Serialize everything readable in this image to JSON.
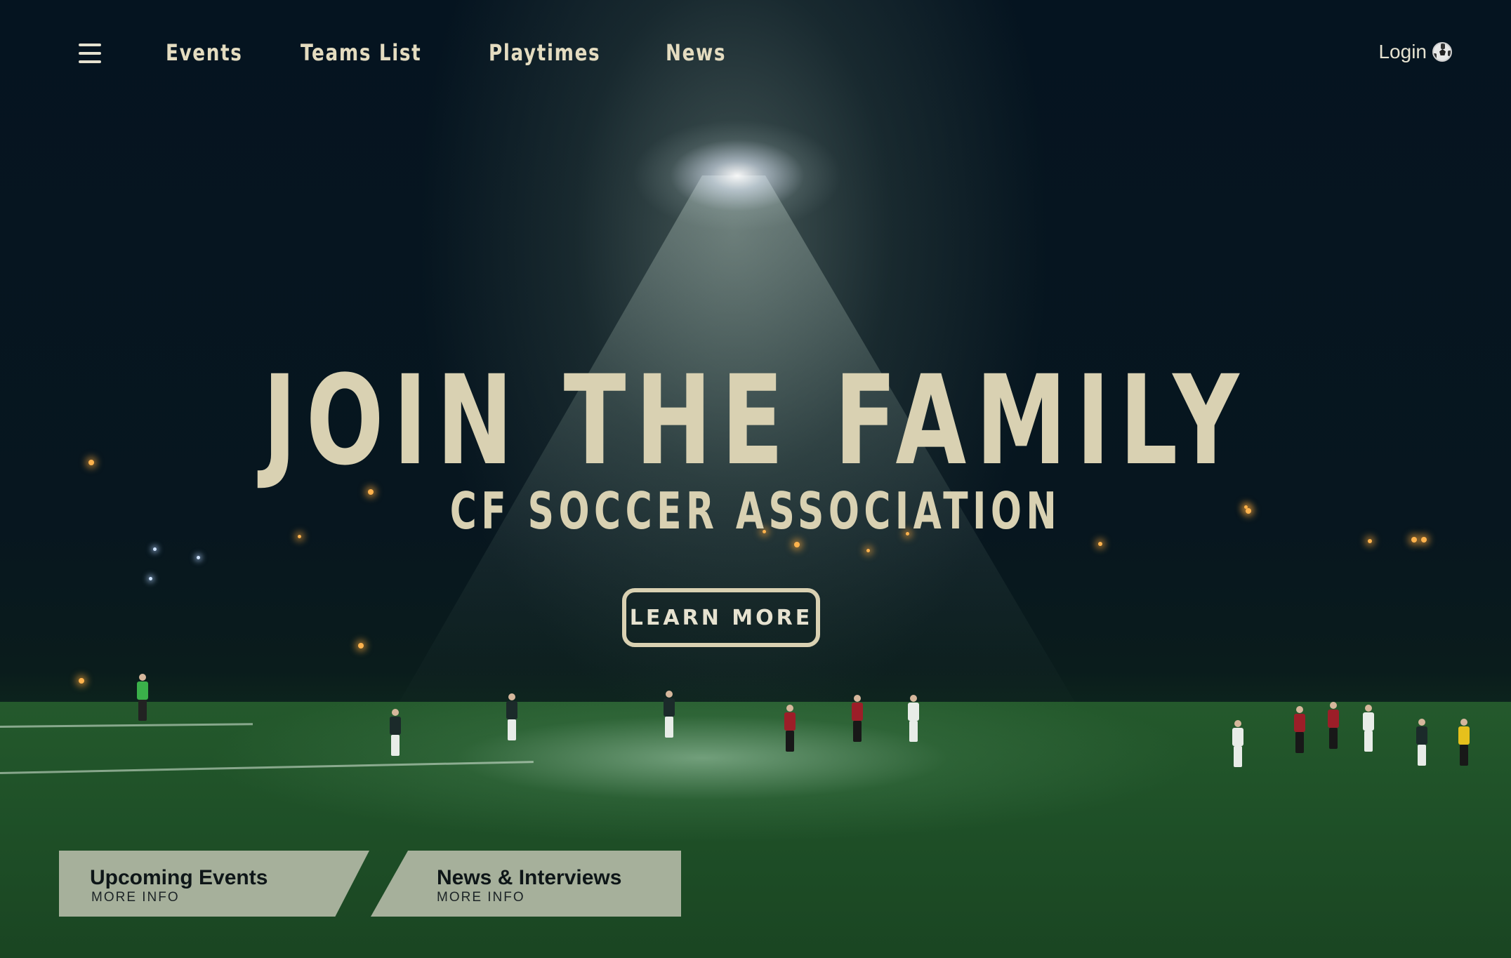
{
  "nav": {
    "links": [
      {
        "label": "Events"
      },
      {
        "label": "Teams List"
      },
      {
        "label": "Playtimes"
      },
      {
        "label": "News"
      }
    ],
    "login_label": "Login",
    "login_icon": "soccer-ball-icon",
    "menu_icon": "hamburger-menu-icon"
  },
  "hero": {
    "title": "JOIN THE FAMILY",
    "subtitle": "CF SOCCER ASSOCIATION",
    "cta_label": "LEARN MORE"
  },
  "cards": [
    {
      "title": "Upcoming Events",
      "subtitle": "MORE INFO"
    },
    {
      "title": "News & Interviews",
      "subtitle": "MORE INFO"
    }
  ],
  "colors": {
    "text_cream": "#d9d1b2",
    "card_bg": "#babeac",
    "sky_dark": "#051420",
    "pitch_green": "#24592c"
  }
}
